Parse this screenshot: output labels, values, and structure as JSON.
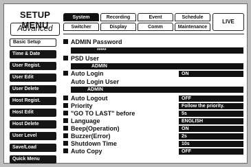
{
  "header": {
    "title": "SETUP MENU",
    "subtitle": "Advanced",
    "live_label": "LIVE"
  },
  "tabs_top": [
    "System",
    "Recording",
    "Event",
    "Schedule"
  ],
  "tabs_bottom": [
    "Switcher",
    "Display",
    "Comm",
    "Maintenance"
  ],
  "sidebar": [
    "Basic Setup",
    "Time & Date",
    "User Regist.",
    "User Edit",
    "User Delete",
    "Host Regist.",
    "Host Edit",
    "Host Delete",
    "User Level",
    "Save/Load",
    "Quick Menu"
  ],
  "settings": {
    "admin_password": {
      "label": "ADMIN Password",
      "value": "*****"
    },
    "psd_user": {
      "label": "PSD User",
      "value": "ADMIN"
    },
    "auto_login": {
      "label": "Auto Login",
      "value": "ON"
    },
    "auto_login_user": {
      "label": "Auto Login User",
      "value": "ADMIN"
    },
    "auto_logout": {
      "label": "Auto Logout",
      "value": "OFF"
    },
    "priority": {
      "label": "Priority",
      "value": "Follow the priority."
    },
    "goto_last": {
      "label": "\"GO TO LAST\" before",
      "value": "5s"
    },
    "language": {
      "label": "Language",
      "value": "ENGLISH"
    },
    "beep": {
      "label": "Beep(Operation)",
      "value": "ON"
    },
    "buzzer": {
      "label": "Buzzer(Error)",
      "value": "2s"
    },
    "shutdown": {
      "label": "Shutdown Time",
      "value": "10s"
    },
    "auto_copy": {
      "label": "Auto Copy",
      "value": "OFF"
    }
  },
  "colors": {
    "dark": "#111111",
    "background": "#bdbdbd"
  }
}
